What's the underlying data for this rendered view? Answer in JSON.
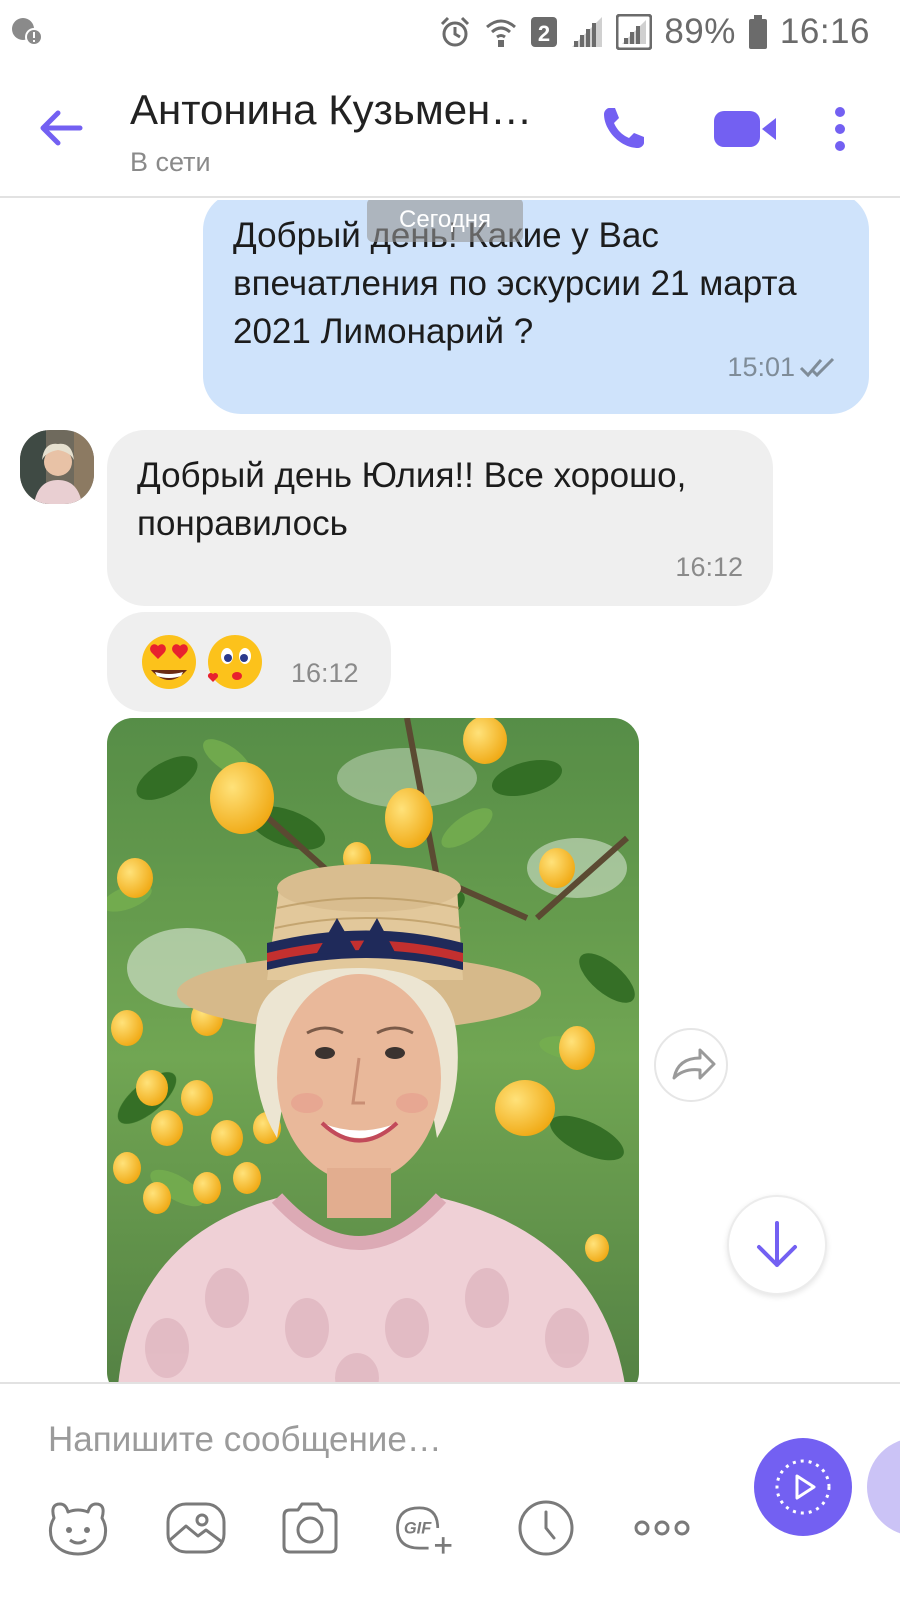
{
  "status_bar": {
    "battery": "89%",
    "time": "16:16",
    "sim_badge": "2"
  },
  "header": {
    "contact_name": "Антонина Кузьмен…",
    "presence": "В сети"
  },
  "chat": {
    "date_separator": "Сегодня",
    "messages": [
      {
        "direction": "outgoing",
        "text": "Добрый день! Какие у Вас впечатления по эскурсии 21 марта 2021 Лимонарий ?",
        "time": "15:01",
        "status_icon": "double-check-icon"
      },
      {
        "direction": "incoming",
        "text": "Добрый день Юлия!! Все хорошо, понравилось",
        "time": "16:12"
      },
      {
        "direction": "incoming",
        "emojis": [
          "heart-eyes-emoji",
          "kiss-emoji"
        ],
        "time": "16:12"
      },
      {
        "direction": "incoming",
        "type": "photo",
        "content": "photo-message"
      }
    ]
  },
  "composer": {
    "placeholder": "Напишите сообщение…",
    "tools": [
      "sticker-icon",
      "gallery-icon",
      "camera-icon",
      "gif-icon",
      "timer-icon",
      "more-icon"
    ]
  },
  "colors": {
    "accent": "#7360f2",
    "outgoing_bubble": "#cfe3fb",
    "incoming_bubble": "#efefef"
  }
}
